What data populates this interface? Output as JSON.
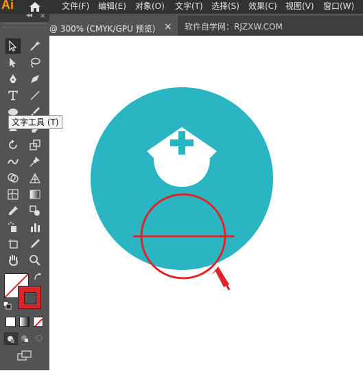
{
  "app": {
    "logo_text": "Ai"
  },
  "menu": {
    "items": [
      "文件(F)",
      "编辑(E)",
      "对象(O)",
      "文字(T)",
      "选择(S)",
      "效果(C)",
      "视图(V)",
      "窗口(W)"
    ]
  },
  "tabs": {
    "active_title": "@ 300% (CMYK/GPU 预览)",
    "close_glyph": "×",
    "second_title": "软件自学网：RJZXW.COM"
  },
  "tooltip": {
    "text": "文字工具 (T)"
  },
  "toolbox": {
    "collapse_glyph": "◂◂",
    "close_glyph": "×",
    "tools": [
      "selection-tool-icon",
      "magic-wand-icon",
      "direct-selection-icon",
      "lasso-icon",
      "pen-icon",
      "curvature-icon",
      "type-tool-icon",
      "line-segment-icon",
      "ellipse-icon",
      "paintbrush-icon",
      "shaper-icon",
      "eraser-icon",
      "rotate-icon",
      "scale-icon",
      "warp-icon",
      "free-transform-icon",
      "puppet-warp-icon",
      "pin-icon",
      "shape-builder-icon",
      "perspective-grid-icon",
      "mesh-icon",
      "gradient-icon",
      "eyedropper-icon",
      "blend-icon",
      "symbol-sprayer-icon",
      "column-graph-icon",
      "artboard-icon",
      "slice-icon",
      "hand-icon",
      "zoom-icon"
    ]
  },
  "colors": {
    "teal": "#29b5c2",
    "red_annotation": "#e0242a",
    "fill_swatch": "#ffffff",
    "stroke_swatch": "#d9262b"
  }
}
